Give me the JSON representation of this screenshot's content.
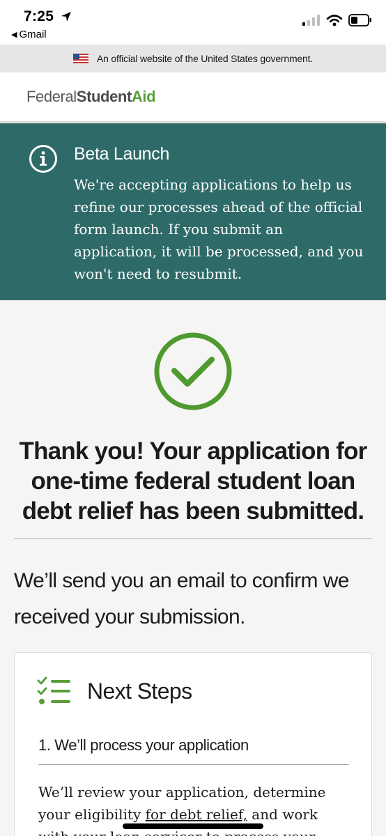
{
  "status_bar": {
    "time": "7:25",
    "back_app": "Gmail"
  },
  "gov_banner": {
    "text": "An official website of the United States government."
  },
  "header": {
    "logo_federal": "Federal",
    "logo_student": "Student",
    "logo_aid": "Aid"
  },
  "beta": {
    "title": "Beta Launch",
    "body": "We're accepting applications to help us refine our processes ahead of the official form launch. If you submit an application, it will be processed, and you won't need to resubmit."
  },
  "confirmation": {
    "title": "Thank you! Your application for one-time federal student loan debt relief has been submitted.",
    "email_note": "We’ll send you an email to confirm we received your submission."
  },
  "next_steps": {
    "title": "Next Steps",
    "step1_heading": "1. We’ll process your application",
    "step1_body_before": "We’ll review your application, determine your eligibility ",
    "step1_body_link": "for debt relief,",
    "step1_body_after": " and work with your loan servicer to process your"
  },
  "colors": {
    "beta_bg": "#2e6b68",
    "accent_green": "#5a9e3a",
    "check_green": "#4f9a2f"
  }
}
